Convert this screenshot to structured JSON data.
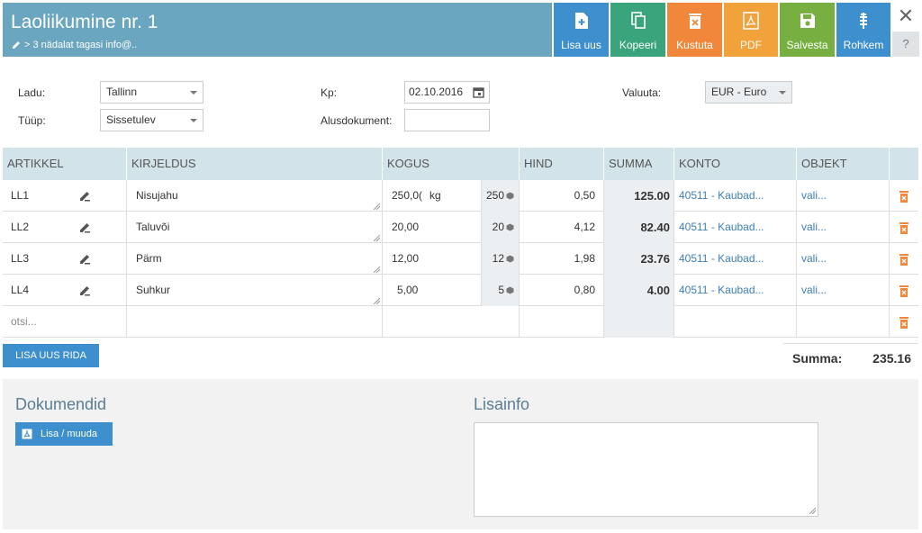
{
  "header": {
    "title": "Laoliikumine nr. 1",
    "subtitle": "> 3 nädalat tagasi info@..",
    "buttons": {
      "new": "Lisa uus",
      "copy": "Kopeeri",
      "delete": "Kustuta",
      "pdf": "PDF",
      "save": "Salvesta",
      "more": "Rohkem"
    },
    "close": "✕",
    "help": "?"
  },
  "form": {
    "ladu_label": "Ladu:",
    "ladu_value": "Tallinn",
    "tuup_label": "Tüüp:",
    "tuup_value": "Sissetulev",
    "kp_label": "Kp:",
    "kp_value": "02.10.2016",
    "alusdokument_label": "Alusdokument:",
    "alusdokument_value": "",
    "valuuta_label": "Valuuta:",
    "valuuta_value": "EUR - Euro"
  },
  "table": {
    "headers": [
      "ARTIKKEL",
      "KIRJELDUS",
      "KOGUS",
      "HIND",
      "SUMMA",
      "KONTO",
      "OBJEKT"
    ],
    "rows": [
      {
        "art": "LL1",
        "desc": "Nisujahu",
        "qty": "250,0(",
        "unit": "kg",
        "stock": "250",
        "price": "0,50",
        "sum": "125.00",
        "konto": "40511 - Kaubad...",
        "obj": "vali..."
      },
      {
        "art": "LL2",
        "desc": "Taluvõi",
        "qty": "20,00",
        "unit": "",
        "stock": "20",
        "price": "4,12",
        "sum": "82.40",
        "konto": "40511 - Kaubad...",
        "obj": "vali..."
      },
      {
        "art": "LL3",
        "desc": "Pärm",
        "qty": "12,00",
        "unit": "",
        "stock": "12",
        "price": "1,98",
        "sum": "23.76",
        "konto": "40511 - Kaubad...",
        "obj": "vali..."
      },
      {
        "art": "LL4",
        "desc": "Suhkur",
        "qty": "5,00",
        "unit": "",
        "stock": "5",
        "price": "0,80",
        "sum": "4.00",
        "konto": "40511 - Kaubad...",
        "obj": "vali..."
      }
    ],
    "search_placeholder": "otsi..."
  },
  "add_row_label": "LISA UUS RIDA",
  "total": {
    "label": "Summa:",
    "value": "235.16"
  },
  "bottom": {
    "documents_title": "Dokumendid",
    "documents_button": "Lisa / muuda",
    "info_title": "Lisainfo"
  },
  "colors": {
    "header": "#6aa6c0",
    "new": "#3d8fcd",
    "copy": "#3aa47d",
    "delete": "#f0873a",
    "pdf": "#f2a23a",
    "save": "#77b041",
    "more": "#3d8fcd",
    "trash": "#f0873a"
  }
}
